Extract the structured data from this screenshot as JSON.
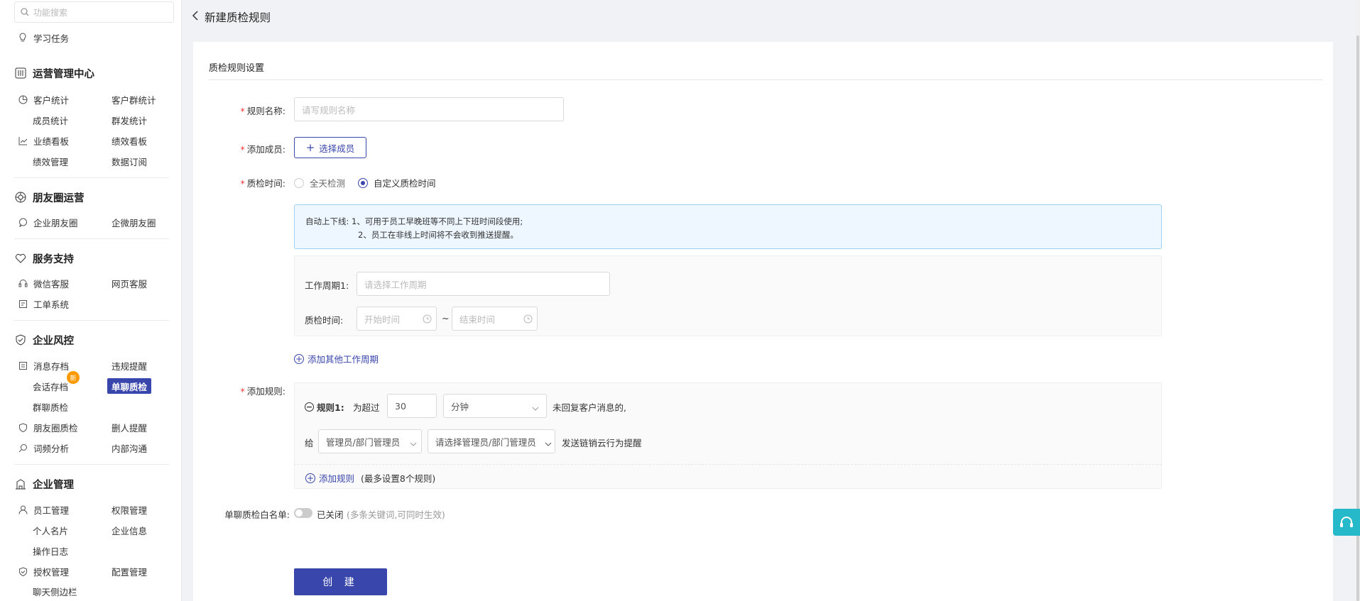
{
  "sidebar": {
    "search_placeholder": "功能搜索",
    "study": "学习任务",
    "groups": {
      "ops": {
        "title": "运营管理中心",
        "items": [
          "客户统计",
          "客户群统计",
          "成员统计",
          "群发统计",
          "业绩看板",
          "绩效看板",
          "绩效管理",
          "数据订阅"
        ]
      },
      "moments": {
        "title": "朋友圈运营",
        "items": [
          "企业朋友圈",
          "企微朋友圈"
        ]
      },
      "service": {
        "title": "服务支持",
        "items": [
          "微信客服",
          "网页客服",
          "工单系统"
        ]
      },
      "risk": {
        "title": "企业风控",
        "items": [
          "消息存档",
          "违规提醒",
          "会话存档",
          "单聊质检",
          "群聊质检",
          "朋友圈质检",
          "删人提醒",
          "词频分析",
          "内部沟通"
        ],
        "badge": "新"
      },
      "enterprise": {
        "title": "企业管理",
        "items": [
          "员工管理",
          "权限管理",
          "个人名片",
          "企业信息",
          "操作日志",
          "授权管理",
          "配置管理",
          "聊天侧边栏"
        ]
      }
    }
  },
  "header": {
    "title": "新建质检规则"
  },
  "form": {
    "section_title": "质检规则设置",
    "name_label": "规则名称:",
    "name_placeholder": "请写规则名称",
    "members_label": "添加成员:",
    "select_members": "选择成员",
    "time_label": "质检时间:",
    "radio_all": "全天检测",
    "radio_custom": "自定义质检时间",
    "tip_prefix": "自动上下线:",
    "tip_line1": "1、可用于员工早晚班等不同上下班时间段使用;",
    "tip_line2": "2、员工在非线上时间将不会收到推送提醒。",
    "period_label": "工作周期1:",
    "period_placeholder": "请选择工作周期",
    "qc_time_label": "质检时间:",
    "start_placeholder": "开始时间",
    "end_placeholder": "结束时间",
    "tilde": "~",
    "add_period": "添加其他工作周期",
    "rules_label": "添加规则:",
    "rule1_title": "规则1:",
    "rule1_exceed": "为超过",
    "rule1_value": "30",
    "rule1_unit": "分钟",
    "rule1_suffix": "未回复客户消息的,",
    "give": "给",
    "role_select": "管理员/部门管理员",
    "manager_select": "请选择管理员/部门管理员",
    "send_text": "发送链销云行为提醒",
    "add_rule": "添加规则",
    "add_rule_note": "(最多设置8个规则)",
    "whitelist_label": "单聊质检白名单:",
    "whitelist_status": "已关闭",
    "whitelist_note": "(多条关键词,可同时生效)",
    "submit": "创 建"
  },
  "colors": {
    "accent": "#3946ab",
    "service_button": "#25b9c9",
    "badge": "#ff9900"
  }
}
